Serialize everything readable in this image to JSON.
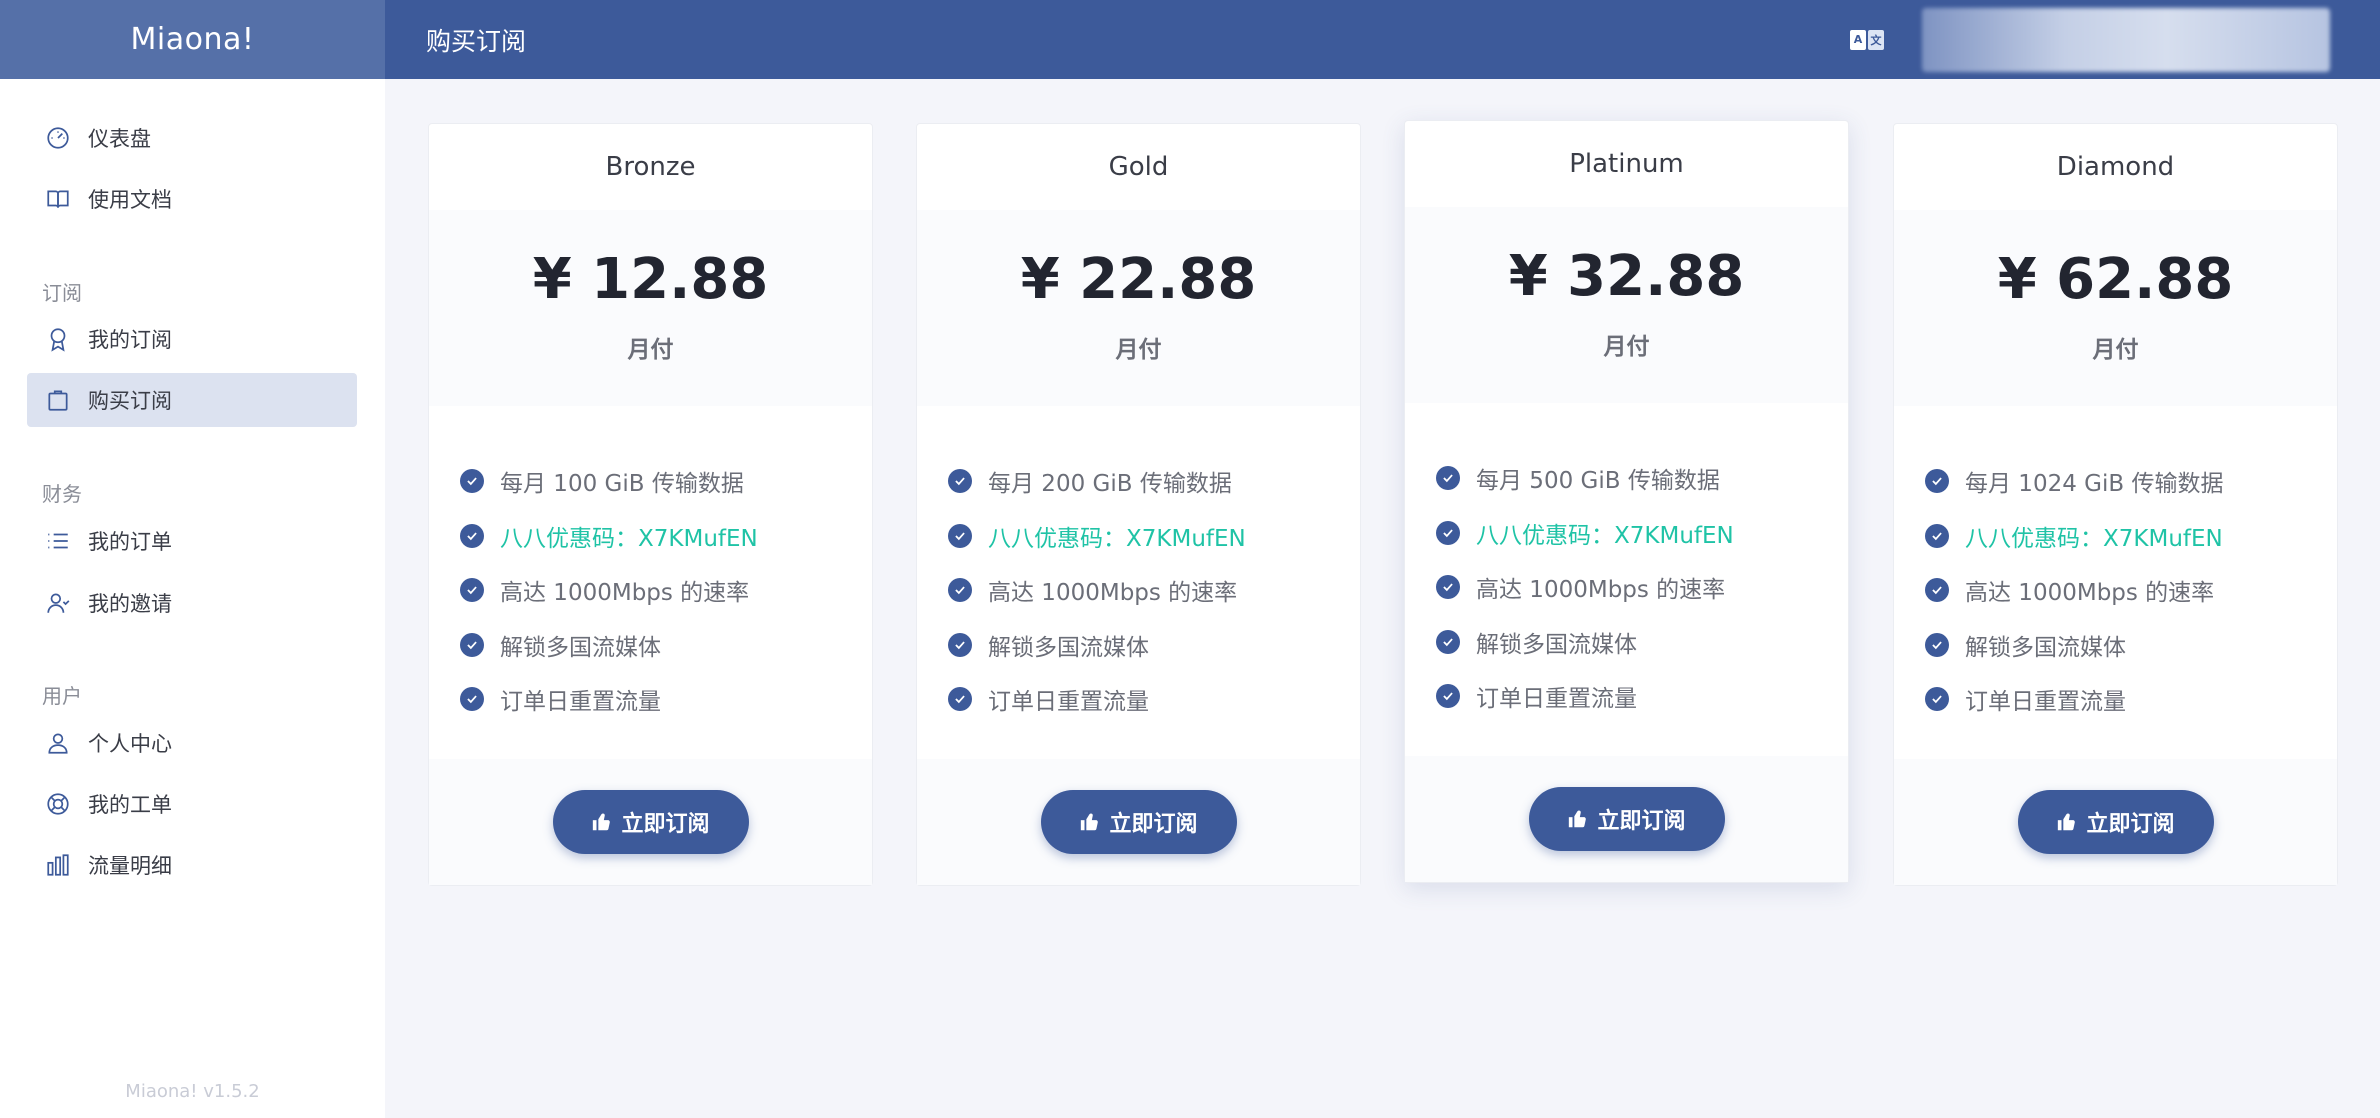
{
  "header": {
    "brand": "Miaona!",
    "title": "购买订阅",
    "lang_icon": "translate-icon"
  },
  "sidebar": {
    "items": [
      {
        "label": "仪表盘",
        "icon": "dashboard-gauge-icon"
      },
      {
        "label": "使用文档",
        "icon": "book-icon"
      }
    ],
    "groups": [
      {
        "title": "订阅",
        "items": [
          {
            "label": "我的订阅",
            "icon": "award-icon"
          },
          {
            "label": "购买订阅",
            "icon": "shopping-bag-icon",
            "active": true
          }
        ]
      },
      {
        "title": "财务",
        "items": [
          {
            "label": "我的订单",
            "icon": "list-icon"
          },
          {
            "label": "我的邀请",
            "icon": "user-invite-icon"
          }
        ]
      },
      {
        "title": "用户",
        "items": [
          {
            "label": "个人中心",
            "icon": "user-icon"
          },
          {
            "label": "我的工单",
            "icon": "lifebuoy-icon"
          },
          {
            "label": "流量明细",
            "icon": "bar-chart-icon"
          }
        ]
      }
    ],
    "version": "Miaona! v1.5.2"
  },
  "plans": [
    {
      "name": "Bronze",
      "price": "¥ 12.88",
      "period": "月付",
      "features": [
        "每月 100 GiB 传输数据",
        "八八优惠码：X7KMufEN",
        "高达 1000Mbps 的速率",
        "解锁多国流媒体",
        "订单日重置流量"
      ],
      "button": "立即订阅"
    },
    {
      "name": "Gold",
      "price": "¥ 22.88",
      "period": "月付",
      "features": [
        "每月 200 GiB 传输数据",
        "八八优惠码：X7KMufEN",
        "高达 1000Mbps 的速率",
        "解锁多国流媒体",
        "订单日重置流量"
      ],
      "button": "立即订阅"
    },
    {
      "name": "Platinum",
      "price": "¥ 32.88",
      "period": "月付",
      "features": [
        "每月 500 GiB 传输数据",
        "八八优惠码：X7KMufEN",
        "高达 1000Mbps 的速率",
        "解锁多国流媒体",
        "订单日重置流量"
      ],
      "button": "立即订阅"
    },
    {
      "name": "Diamond",
      "price": "¥ 62.88",
      "period": "月付",
      "features": [
        "每月 1024 GiB 传输数据",
        "八八优惠码：X7KMufEN",
        "高达 1000Mbps 的速率",
        "解锁多国流媒体",
        "订单日重置流量"
      ],
      "button": "立即订阅"
    }
  ],
  "colors": {
    "primary": "#3d5a9a",
    "brand_bg": "#5570a8",
    "promo_text": "#1fc3a6",
    "active_menu_bg": "#dce2f0",
    "page_bg": "#f4f5fa"
  }
}
